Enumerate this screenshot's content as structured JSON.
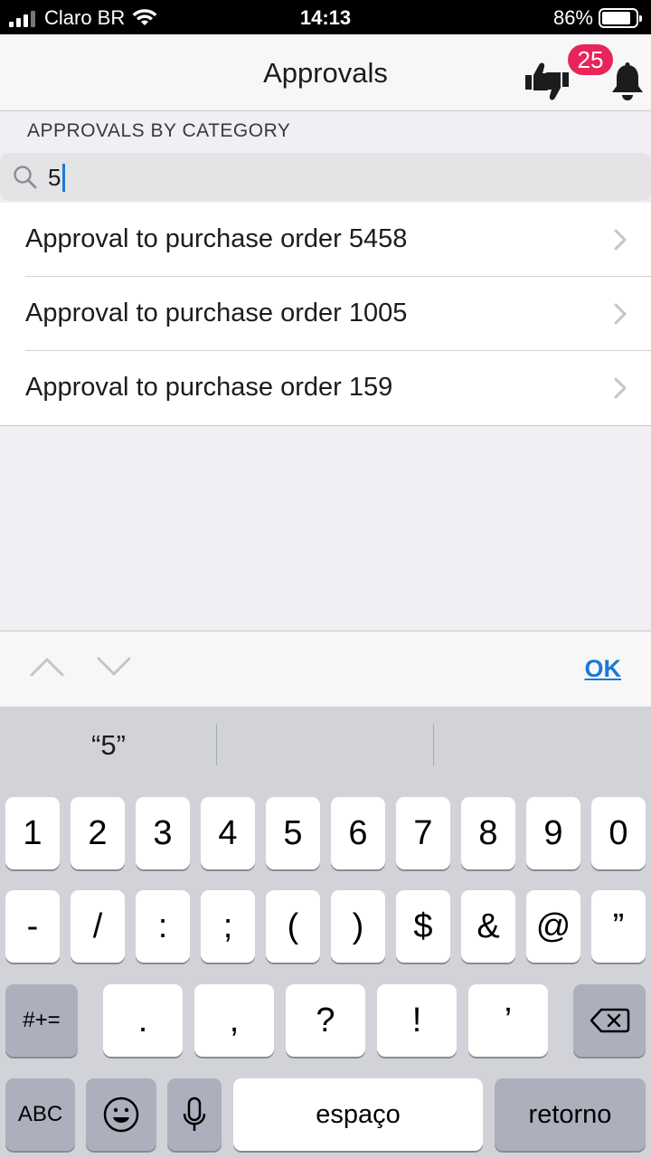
{
  "status_bar": {
    "carrier": "Claro BR",
    "time": "14:13",
    "battery": "86%",
    "battery_level": 0.86
  },
  "nav": {
    "title": "Approvals",
    "badge_count": "25"
  },
  "section_header": "APPROVALS BY CATEGORY",
  "search": {
    "value": "5",
    "placeholder": ""
  },
  "list": [
    {
      "label": "Approval to purchase order 5458"
    },
    {
      "label": "Approval to purchase order 1005"
    },
    {
      "label": "Approval to purchase order 159"
    }
  ],
  "accessory": {
    "ok_label": "OK"
  },
  "keyboard": {
    "suggestions": [
      "“5”",
      "",
      ""
    ],
    "row1": [
      "1",
      "2",
      "3",
      "4",
      "5",
      "6",
      "7",
      "8",
      "9",
      "0"
    ],
    "row2": [
      "-",
      "/",
      ":",
      ";",
      "(",
      ")",
      "$",
      "&",
      "@",
      "”"
    ],
    "row3_mode": "#+=",
    "row3": [
      ".",
      ",",
      "?",
      "!",
      "’"
    ],
    "abc_label": "ABC",
    "space_label": "espaço",
    "return_label": "retorno"
  },
  "colors": {
    "badge": "#e8245b",
    "accent": "#1a7ad6",
    "keyboard_bg": "#d1d3d9"
  }
}
